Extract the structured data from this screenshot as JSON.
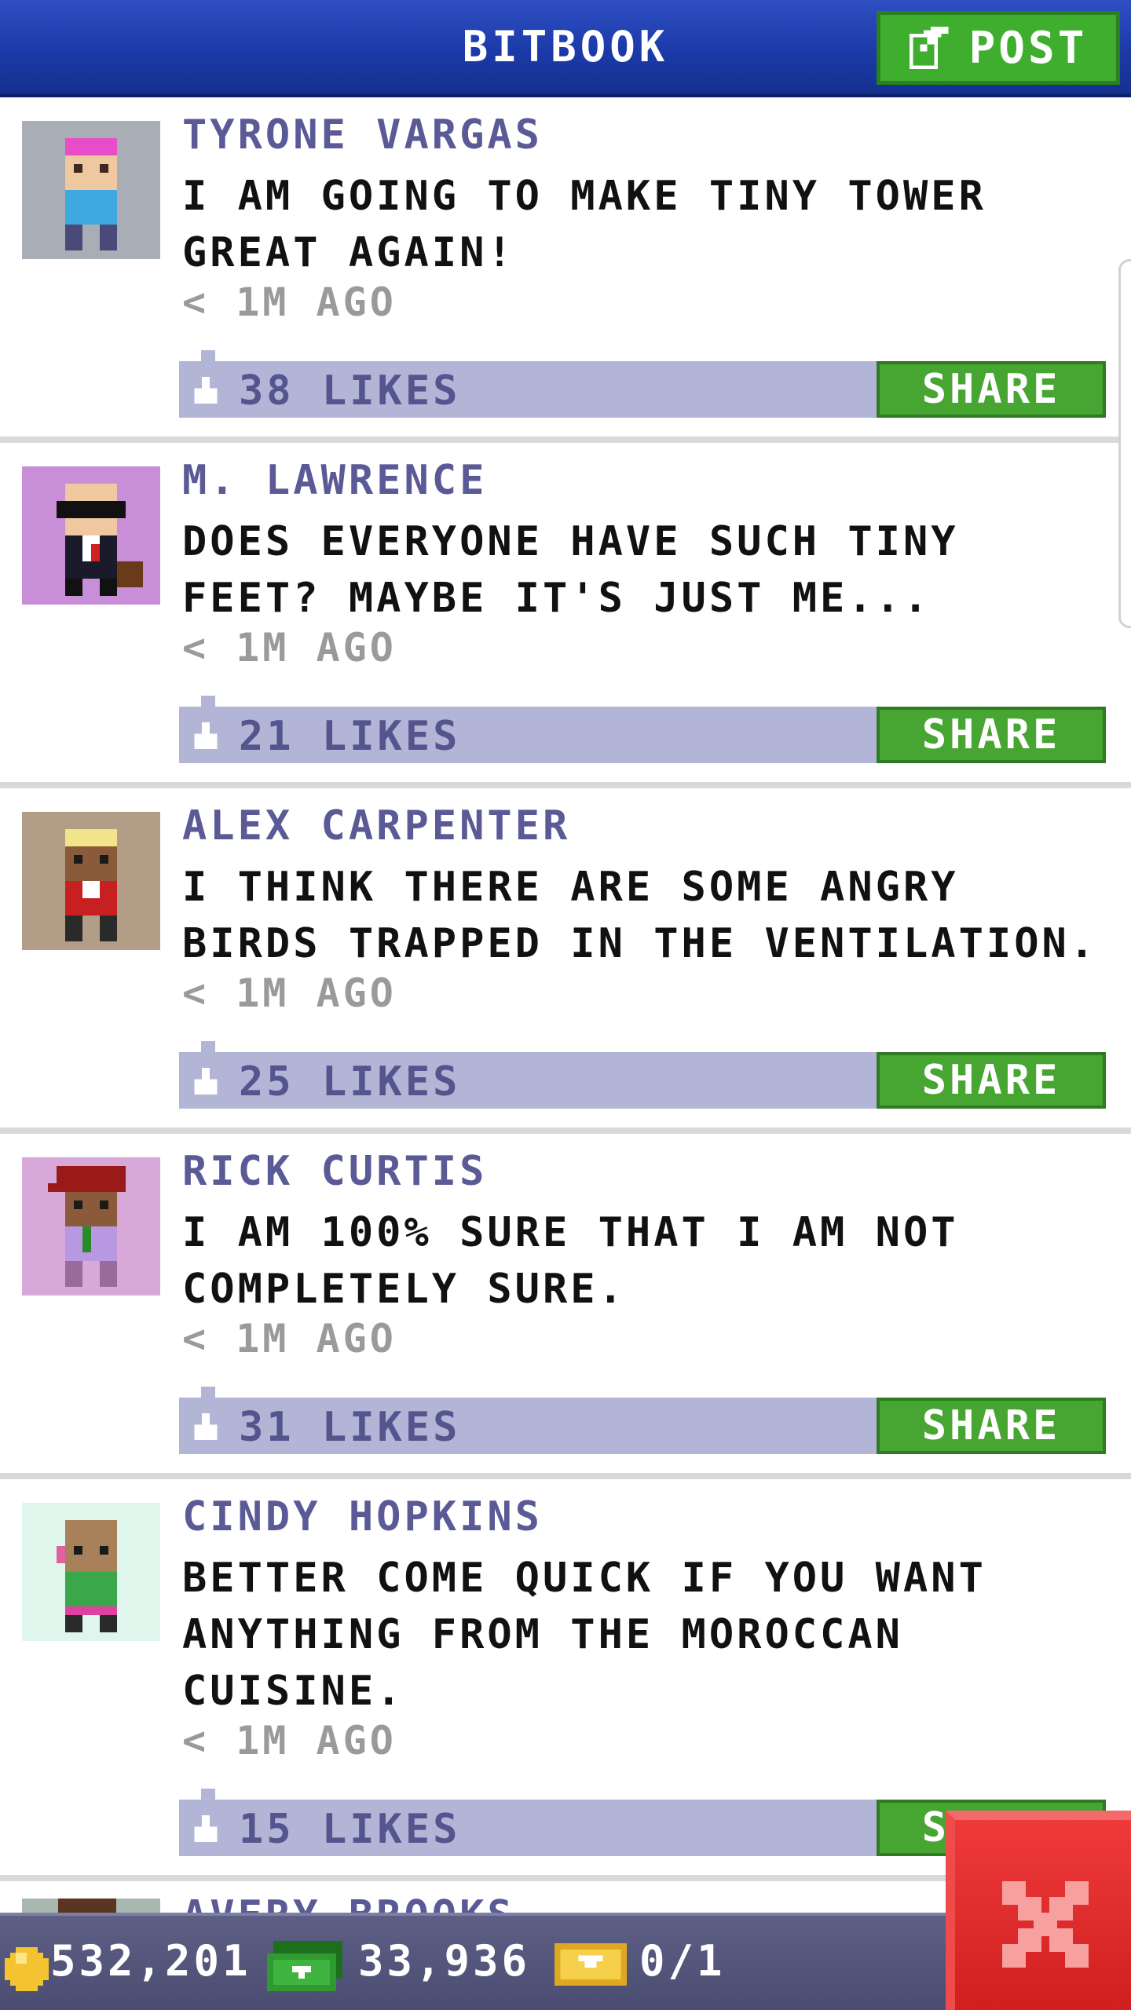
{
  "header": {
    "title": "BITBOOK",
    "post_label": "POST"
  },
  "posts": [
    {
      "author": "TYRONE VARGAS",
      "message": "I AM GOING TO MAKE TINY TOWER GREAT AGAIN!",
      "time": "< 1M AGO",
      "likes": "38 LIKES",
      "share": "SHARE"
    },
    {
      "author": "M. LAWRENCE",
      "message": "DOES EVERYONE HAVE SUCH TINY FEET? MAYBE IT'S JUST ME...",
      "time": "< 1M AGO",
      "likes": "21 LIKES",
      "share": "SHARE"
    },
    {
      "author": "ALEX CARPENTER",
      "message": "I THINK THERE ARE SOME ANGRY BIRDS TRAPPED IN THE VENTILATION.",
      "time": "< 1M AGO",
      "likes": "25 LIKES",
      "share": "SHARE"
    },
    {
      "author": "RICK CURTIS",
      "message": "I AM 100% SURE THAT I AM NOT COMPLETELY SURE.",
      "time": "< 1M AGO",
      "likes": "31 LIKES",
      "share": "SHARE"
    },
    {
      "author": "CINDY HOPKINS",
      "message": "BETTER COME QUICK IF YOU WANT ANYTHING FROM THE MOROCCAN CUISINE.",
      "time": "< 1M AGO",
      "likes": "15 LIKES",
      "share": "SHARE"
    }
  ],
  "partial_post": {
    "author": "AVERY BROOKS"
  },
  "footer": {
    "coins": "532,201",
    "cash": "33,936",
    "bux": "0/1"
  },
  "colors": {
    "header_blue": "#1b3aa8",
    "share_green": "#47a532",
    "likes_bar": "#b3b5d6",
    "author_text": "#5a5a96",
    "close_red": "#d01f1f"
  },
  "icons": [
    "post-edit-icon",
    "like-icon",
    "coin-icon",
    "cash-icon",
    "bux-icon",
    "close-icon"
  ]
}
